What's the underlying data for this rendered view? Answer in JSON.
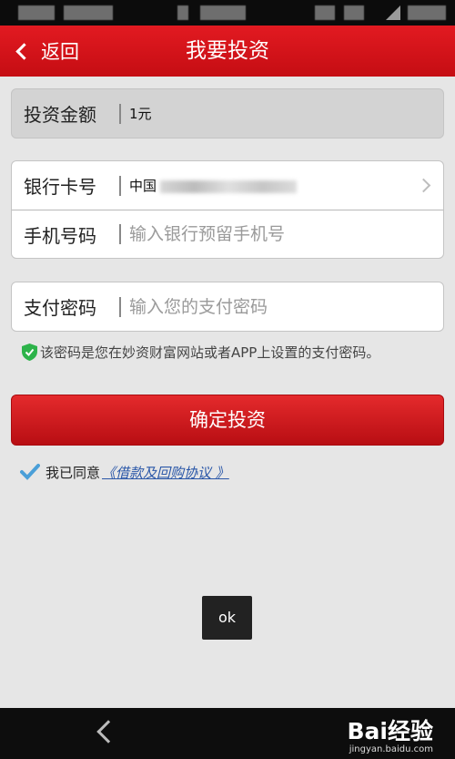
{
  "navbar": {
    "back_label": "返回",
    "title": "我要投资"
  },
  "amount": {
    "label": "投资金额",
    "value": "1元"
  },
  "bank_card": {
    "label": "银行卡号",
    "prefix": "中国"
  },
  "phone": {
    "label": "手机号码",
    "placeholder": "输入银行预留手机号"
  },
  "password": {
    "label": "支付密码",
    "placeholder": "输入您的支付密码"
  },
  "hint": {
    "text": "该密码是您在妙资财富网站或者APP上设置的支付密码。"
  },
  "confirm_label": "确定投资",
  "agreement": {
    "prefix": "我已同意",
    "link": "《借款及回购协议 》"
  },
  "toast": "ok",
  "watermark": {
    "brand": "Bai经验",
    "url": "jingyan.baidu.com"
  },
  "colors": {
    "primary": "#d4151b",
    "link": "#2a57a8",
    "shield": "#2db34a"
  }
}
